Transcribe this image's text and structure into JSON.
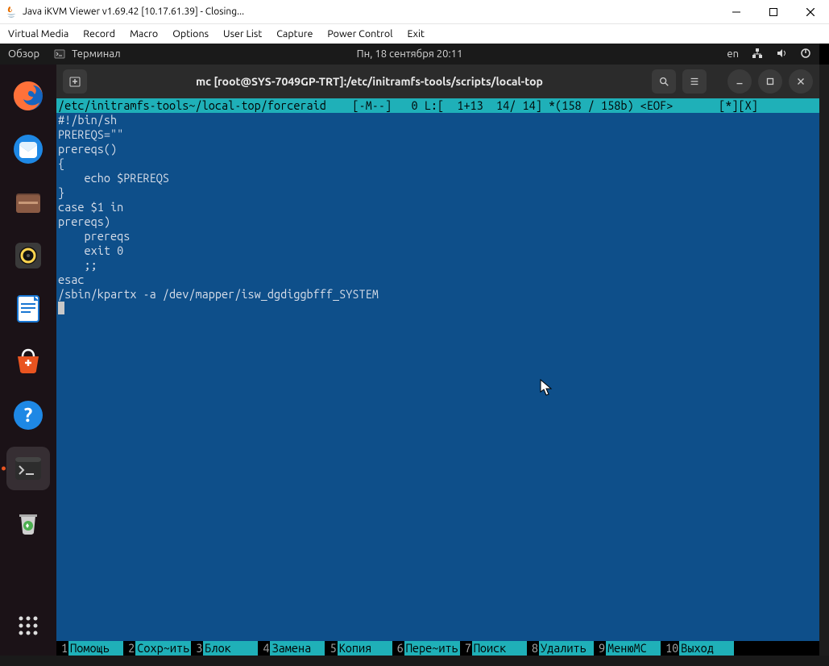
{
  "window": {
    "title": "Java iKVM Viewer v1.69.42 [10.17.61.39]  - Closing..."
  },
  "menubar": {
    "items": [
      "Virtual Media",
      "Record",
      "Macro",
      "Options",
      "User List",
      "Capture",
      "Power Control",
      "Exit"
    ]
  },
  "gnome_top": {
    "overview": "Обзор",
    "terminal_label": "Терминал",
    "datetime": "Пн, 18 сентября  20:11",
    "lang": "en"
  },
  "terminal": {
    "title": "mc [root@SYS-7049GP-TRT]:/etc/initramfs-tools/scripts/local-top",
    "status_path": "/etc/initramfs-tools~/local-top/forceraid",
    "status_rest": "    [-M--]   0 L:[  1+13  14/ 14] *(158 / 158b) <EOF>       [*][X]",
    "code": "#!/bin/sh\nPREREQS=\"\"\nprereqs()\n{\n    echo $PREREQS\n}\ncase $1 in\nprereqs)\n    prereqs\n    exit 0\n    ;;\nesac\n/sbin/kpartx -a /dev/mapper/isw_dgdiggbfff_SYSTEM"
  },
  "fkeys": [
    {
      "n": "1",
      "label": "Помощь "
    },
    {
      "n": "2",
      "label": "Сохр~ить"
    },
    {
      "n": "3",
      "label": "Блок   "
    },
    {
      "n": "4",
      "label": "Замена "
    },
    {
      "n": "5",
      "label": "Копия  "
    },
    {
      "n": "6",
      "label": "Пере~ить"
    },
    {
      "n": "7",
      "label": "Поиск  "
    },
    {
      "n": "8",
      "label": "Удалить"
    },
    {
      "n": "9",
      "label": "МенюMC "
    },
    {
      "n": "10",
      "label": "Выход  "
    }
  ],
  "dock_apps": [
    {
      "name": "firefox"
    },
    {
      "name": "thunderbird"
    },
    {
      "name": "files"
    },
    {
      "name": "rhythmbox"
    },
    {
      "name": "libreoffice-writer"
    },
    {
      "name": "ubuntu-software"
    },
    {
      "name": "help"
    },
    {
      "name": "terminal"
    },
    {
      "name": "trash"
    }
  ]
}
